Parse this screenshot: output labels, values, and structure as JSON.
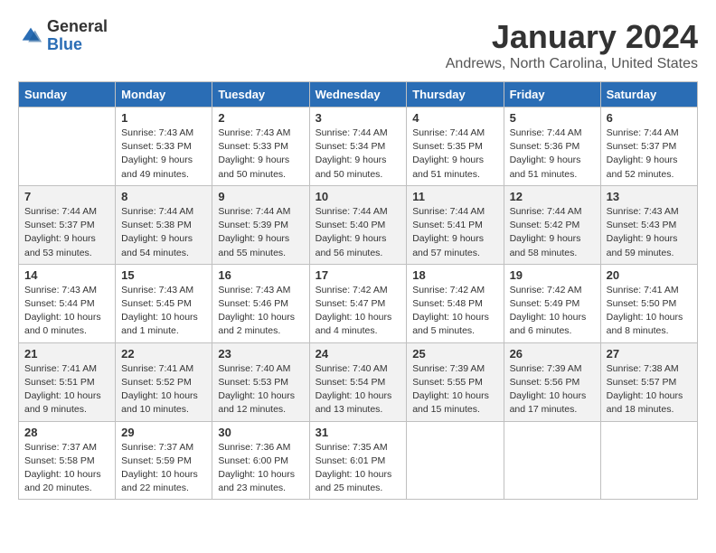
{
  "logo": {
    "general": "General",
    "blue": "Blue"
  },
  "title": "January 2024",
  "location": "Andrews, North Carolina, United States",
  "days_header": [
    "Sunday",
    "Monday",
    "Tuesday",
    "Wednesday",
    "Thursday",
    "Friday",
    "Saturday"
  ],
  "weeks": [
    [
      {
        "day": "",
        "info": ""
      },
      {
        "day": "1",
        "info": "Sunrise: 7:43 AM\nSunset: 5:33 PM\nDaylight: 9 hours\nand 49 minutes."
      },
      {
        "day": "2",
        "info": "Sunrise: 7:43 AM\nSunset: 5:33 PM\nDaylight: 9 hours\nand 50 minutes."
      },
      {
        "day": "3",
        "info": "Sunrise: 7:44 AM\nSunset: 5:34 PM\nDaylight: 9 hours\nand 50 minutes."
      },
      {
        "day": "4",
        "info": "Sunrise: 7:44 AM\nSunset: 5:35 PM\nDaylight: 9 hours\nand 51 minutes."
      },
      {
        "day": "5",
        "info": "Sunrise: 7:44 AM\nSunset: 5:36 PM\nDaylight: 9 hours\nand 51 minutes."
      },
      {
        "day": "6",
        "info": "Sunrise: 7:44 AM\nSunset: 5:37 PM\nDaylight: 9 hours\nand 52 minutes."
      }
    ],
    [
      {
        "day": "7",
        "info": "Sunrise: 7:44 AM\nSunset: 5:37 PM\nDaylight: 9 hours\nand 53 minutes."
      },
      {
        "day": "8",
        "info": "Sunrise: 7:44 AM\nSunset: 5:38 PM\nDaylight: 9 hours\nand 54 minutes."
      },
      {
        "day": "9",
        "info": "Sunrise: 7:44 AM\nSunset: 5:39 PM\nDaylight: 9 hours\nand 55 minutes."
      },
      {
        "day": "10",
        "info": "Sunrise: 7:44 AM\nSunset: 5:40 PM\nDaylight: 9 hours\nand 56 minutes."
      },
      {
        "day": "11",
        "info": "Sunrise: 7:44 AM\nSunset: 5:41 PM\nDaylight: 9 hours\nand 57 minutes."
      },
      {
        "day": "12",
        "info": "Sunrise: 7:44 AM\nSunset: 5:42 PM\nDaylight: 9 hours\nand 58 minutes."
      },
      {
        "day": "13",
        "info": "Sunrise: 7:43 AM\nSunset: 5:43 PM\nDaylight: 9 hours\nand 59 minutes."
      }
    ],
    [
      {
        "day": "14",
        "info": "Sunrise: 7:43 AM\nSunset: 5:44 PM\nDaylight: 10 hours\nand 0 minutes."
      },
      {
        "day": "15",
        "info": "Sunrise: 7:43 AM\nSunset: 5:45 PM\nDaylight: 10 hours\nand 1 minute."
      },
      {
        "day": "16",
        "info": "Sunrise: 7:43 AM\nSunset: 5:46 PM\nDaylight: 10 hours\nand 2 minutes."
      },
      {
        "day": "17",
        "info": "Sunrise: 7:42 AM\nSunset: 5:47 PM\nDaylight: 10 hours\nand 4 minutes."
      },
      {
        "day": "18",
        "info": "Sunrise: 7:42 AM\nSunset: 5:48 PM\nDaylight: 10 hours\nand 5 minutes."
      },
      {
        "day": "19",
        "info": "Sunrise: 7:42 AM\nSunset: 5:49 PM\nDaylight: 10 hours\nand 6 minutes."
      },
      {
        "day": "20",
        "info": "Sunrise: 7:41 AM\nSunset: 5:50 PM\nDaylight: 10 hours\nand 8 minutes."
      }
    ],
    [
      {
        "day": "21",
        "info": "Sunrise: 7:41 AM\nSunset: 5:51 PM\nDaylight: 10 hours\nand 9 minutes."
      },
      {
        "day": "22",
        "info": "Sunrise: 7:41 AM\nSunset: 5:52 PM\nDaylight: 10 hours\nand 10 minutes."
      },
      {
        "day": "23",
        "info": "Sunrise: 7:40 AM\nSunset: 5:53 PM\nDaylight: 10 hours\nand 12 minutes."
      },
      {
        "day": "24",
        "info": "Sunrise: 7:40 AM\nSunset: 5:54 PM\nDaylight: 10 hours\nand 13 minutes."
      },
      {
        "day": "25",
        "info": "Sunrise: 7:39 AM\nSunset: 5:55 PM\nDaylight: 10 hours\nand 15 minutes."
      },
      {
        "day": "26",
        "info": "Sunrise: 7:39 AM\nSunset: 5:56 PM\nDaylight: 10 hours\nand 17 minutes."
      },
      {
        "day": "27",
        "info": "Sunrise: 7:38 AM\nSunset: 5:57 PM\nDaylight: 10 hours\nand 18 minutes."
      }
    ],
    [
      {
        "day": "28",
        "info": "Sunrise: 7:37 AM\nSunset: 5:58 PM\nDaylight: 10 hours\nand 20 minutes."
      },
      {
        "day": "29",
        "info": "Sunrise: 7:37 AM\nSunset: 5:59 PM\nDaylight: 10 hours\nand 22 minutes."
      },
      {
        "day": "30",
        "info": "Sunrise: 7:36 AM\nSunset: 6:00 PM\nDaylight: 10 hours\nand 23 minutes."
      },
      {
        "day": "31",
        "info": "Sunrise: 7:35 AM\nSunset: 6:01 PM\nDaylight: 10 hours\nand 25 minutes."
      },
      {
        "day": "",
        "info": ""
      },
      {
        "day": "",
        "info": ""
      },
      {
        "day": "",
        "info": ""
      }
    ]
  ]
}
